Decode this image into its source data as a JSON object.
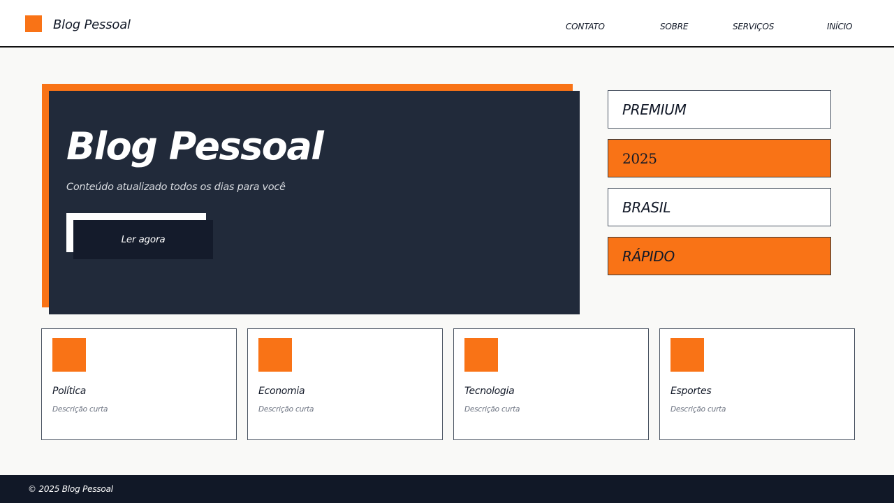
{
  "header": {
    "title": "Blog Pessoal",
    "nav": {
      "contato": "CONTATO",
      "sobre": "SOBRE",
      "servicos": "SERVIÇOS",
      "inicio": "INÍCIO"
    }
  },
  "hero": {
    "title": "Blog Pessoal",
    "subtitle": "Conteúdo atualizado todos os dias para você",
    "cta_label": "Ler agora"
  },
  "tags": [
    "PREMIUM",
    "2025",
    "BRASIL",
    "RÁPIDO"
  ],
  "cards": [
    {
      "title": "Política",
      "description": "Descrição curta"
    },
    {
      "title": "Economia",
      "description": "Descrição curta"
    },
    {
      "title": "Tecnologia",
      "description": "Descrição curta"
    },
    {
      "title": "Esportes",
      "description": "Descrição curta"
    }
  ],
  "footer": {
    "copyright": "© 2025 Blog Pessoal"
  },
  "colors": {
    "accent": "#f97316",
    "dark": "#212a3a",
    "darker": "#111827"
  }
}
